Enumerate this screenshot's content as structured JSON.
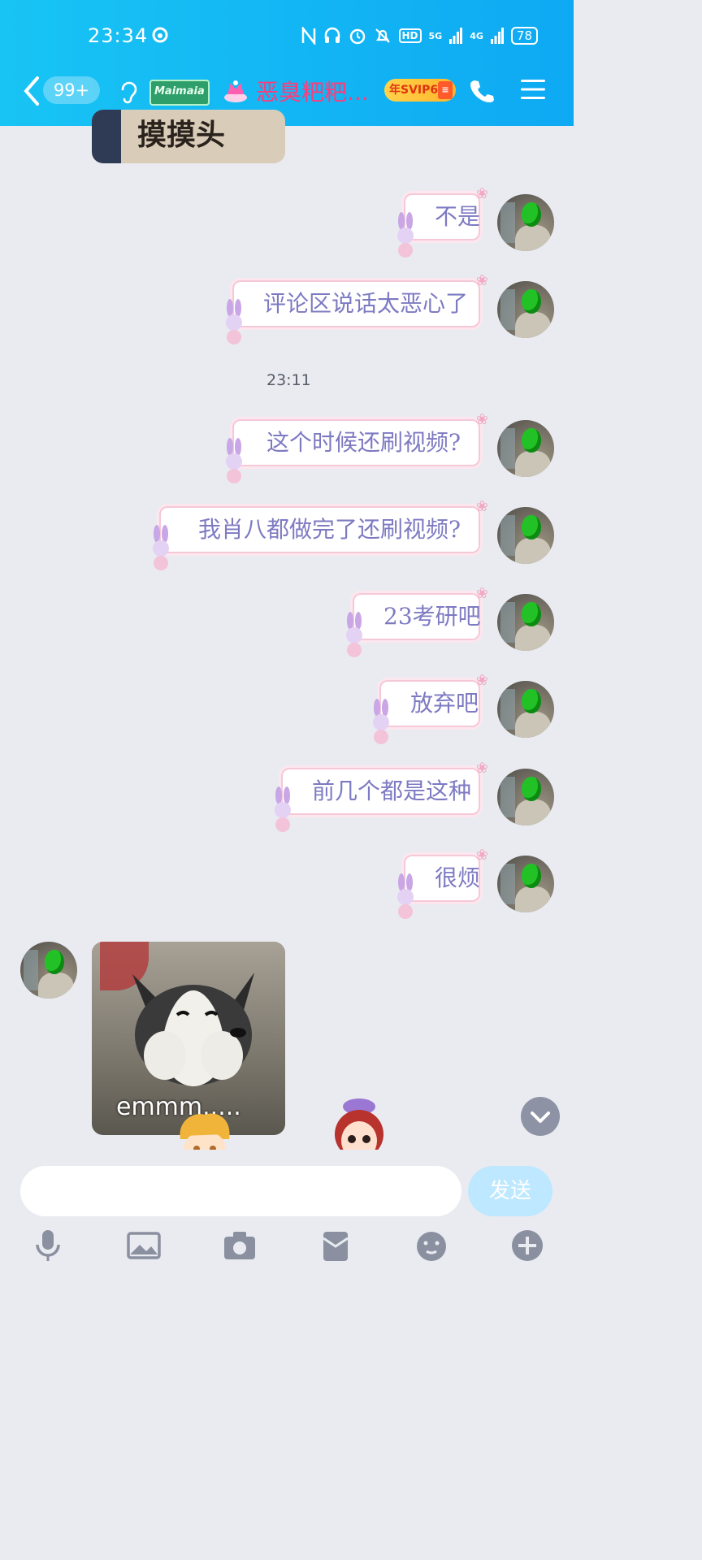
{
  "status_bar": {
    "time": "23:34",
    "hd_label": "HD",
    "net_5g": "5G",
    "net_4g": "4G",
    "battery": "78"
  },
  "nav": {
    "unread_badge": "99+",
    "name_tag": "Maimaia",
    "title": "恶臭粑粑...",
    "vip_badge": "年SVIP6"
  },
  "chat": {
    "top_image_text": "摸摸头",
    "time_separator": "23:11",
    "messages": [
      {
        "text": "不是"
      },
      {
        "text": "评论区说话太恶心了"
      },
      {
        "text": "这个时候还刷视频?"
      },
      {
        "text": "我肖八都做完了还刷视频?"
      },
      {
        "text": "23考研吧"
      },
      {
        "text": "放弃吧"
      },
      {
        "text": "前几个都是这种"
      },
      {
        "text": "很烦"
      }
    ],
    "incoming_sticker_caption": "emmm....."
  },
  "input": {
    "placeholder": "",
    "send_label": "发送"
  },
  "toolbar": {
    "icons": [
      "microphone-icon",
      "image-icon",
      "camera-icon",
      "red-packet-icon",
      "emoji-icon",
      "plus-icon"
    ]
  },
  "colors": {
    "header": "#18c4f4",
    "bubble_text": "#7d7ac2",
    "title": "#ff3b7a",
    "send_button": "#bde8ff"
  }
}
